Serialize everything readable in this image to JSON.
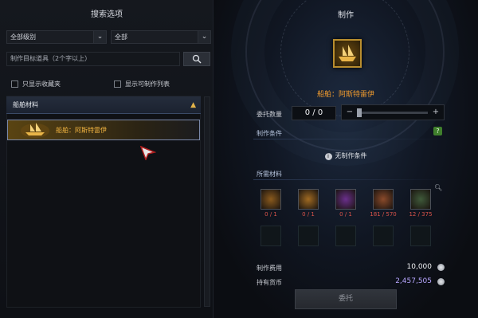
{
  "left": {
    "title": "搜索选项",
    "grade_select": "全部级别",
    "type_select": "全部",
    "search_placeholder": "制作目标道具（2个字以上）",
    "search_icon": "magnifier-icon",
    "check_favorites": "只显示收藏夹",
    "check_craftable": "显示可制作列表",
    "category": "船舶材料",
    "item_label": "船舶：阿斯特雷伊"
  },
  "right": {
    "title": "制作",
    "ship_name": "船舶：阿斯特雷伊",
    "commission_label": "委托数量",
    "quantity": "0 / 0",
    "conditions_label": "制作条件",
    "no_conditions": "无制作条件",
    "materials_label": "所需材料",
    "materials": [
      {
        "icon": "rolled-scroll-icon",
        "count": "0 / 1",
        "color": "#d9534a",
        "tint": "#8a5a1d"
      },
      {
        "icon": "parchment-icon",
        "count": "0 / 1",
        "color": "#d9534a",
        "tint": "#a06a22"
      },
      {
        "icon": "purple-scroll-icon",
        "count": "0 / 1",
        "color": "#d9534a",
        "tint": "#6a2f8c"
      },
      {
        "icon": "timber-log-icon",
        "count": "181 / 570",
        "color": "#d9534a",
        "tint": "#8a4a2a"
      },
      {
        "icon": "gear-part-icon",
        "count": "12 / 375",
        "color": "#d9534a",
        "tint": "#3f5a3a"
      }
    ],
    "cost_label": "制作费用",
    "cost_value": "10,000",
    "owned_label": "持有货币",
    "owned_value": "2,457,505",
    "commission_button": "委托"
  },
  "colors": {
    "accent_gold": "#ef9a2e",
    "owned_currency": "#b7a6ff",
    "help_green": "#3f7f2c"
  }
}
